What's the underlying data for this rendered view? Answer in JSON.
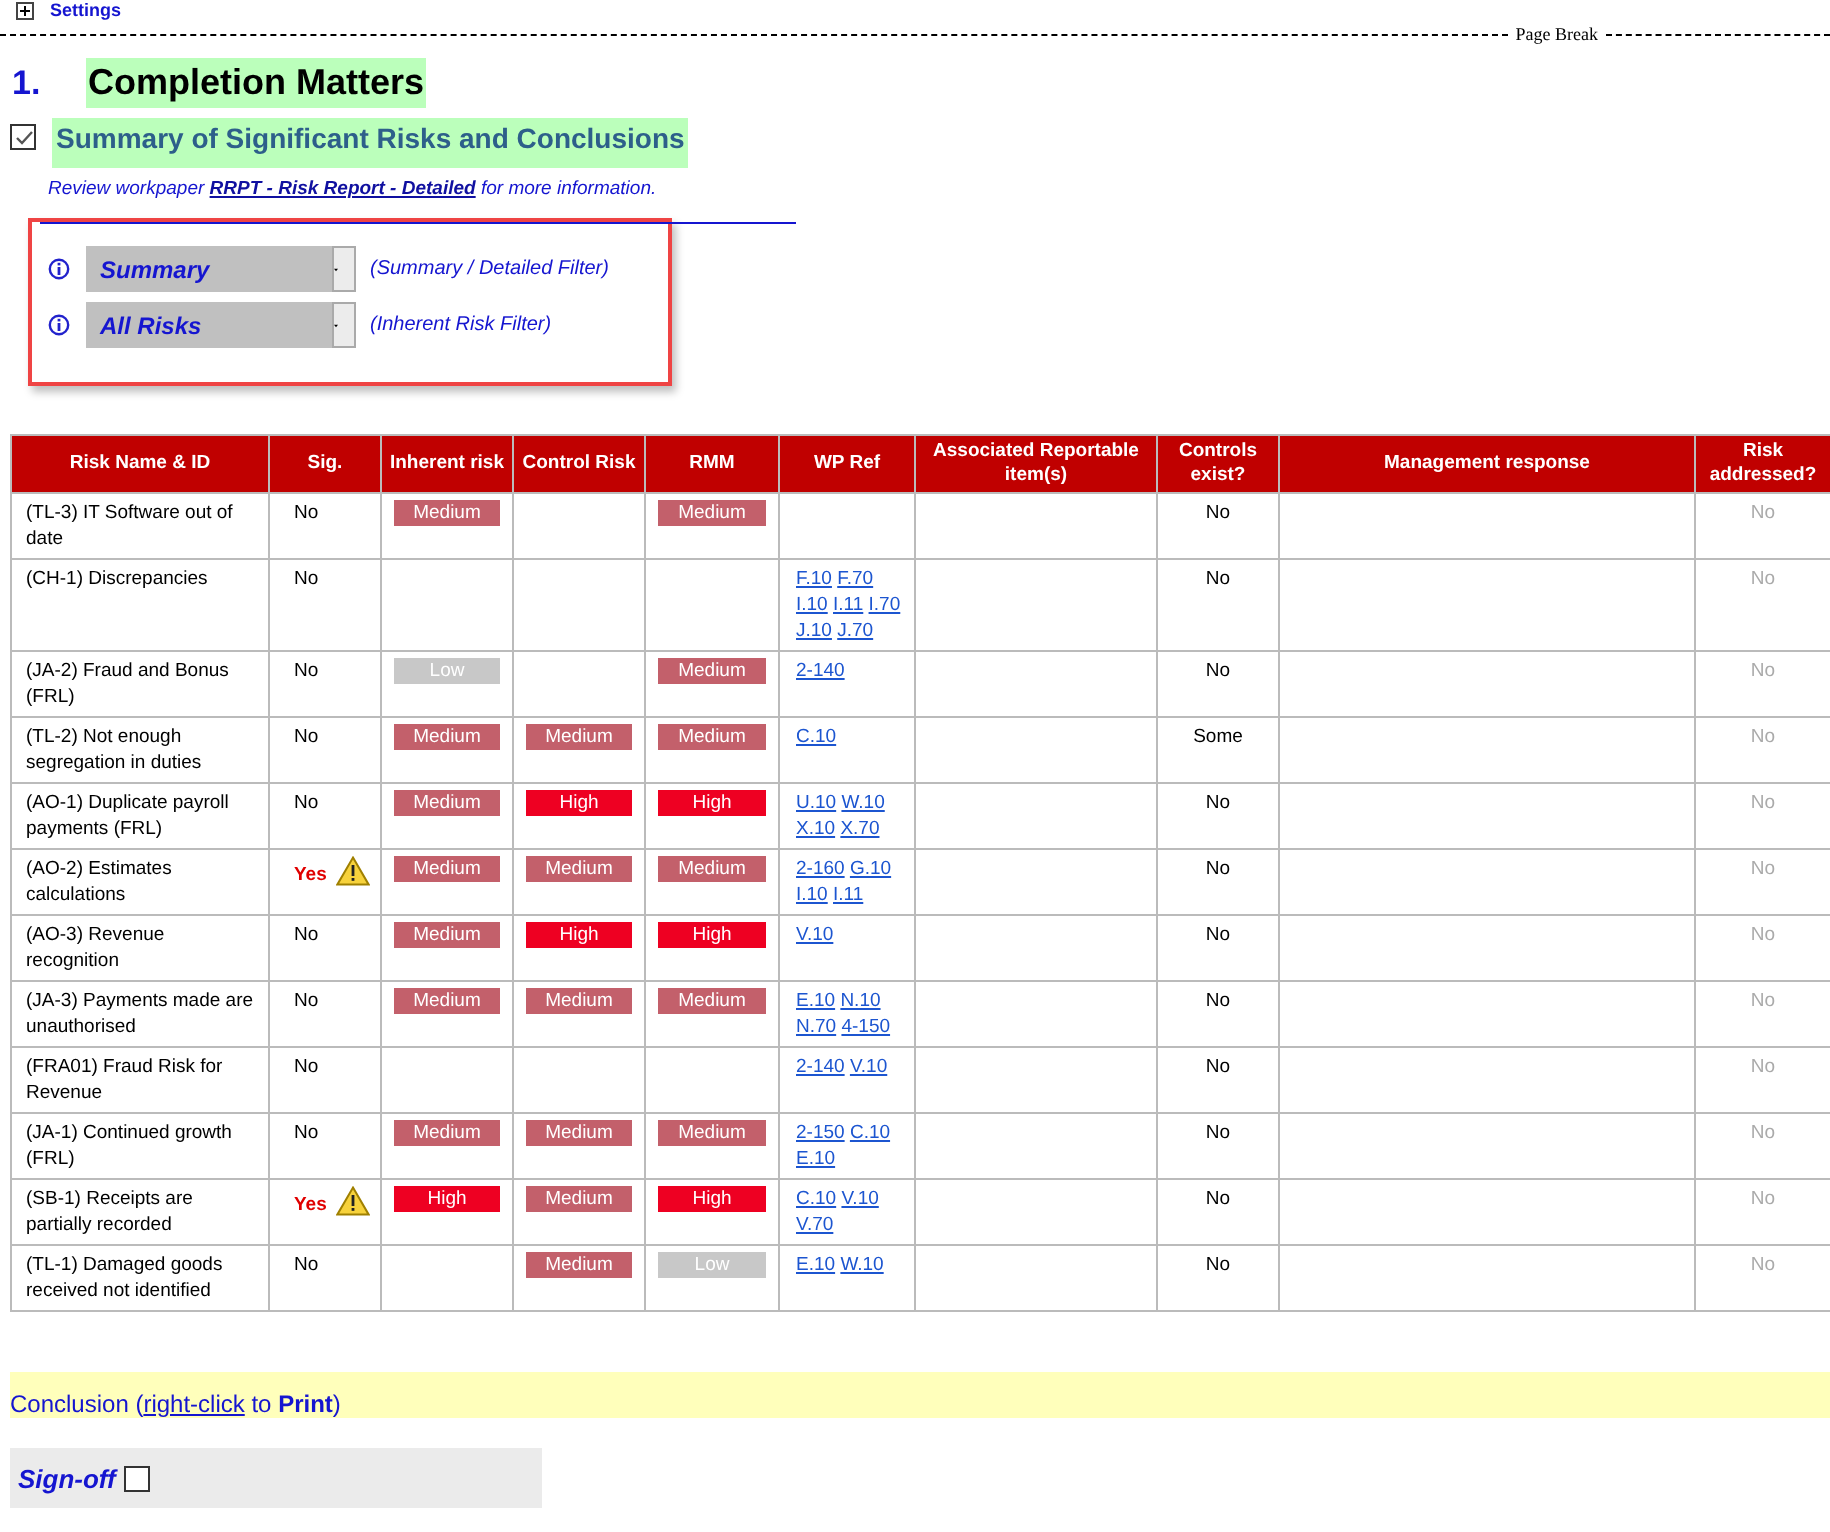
{
  "settings_link": "Settings",
  "page_break": "Page Break",
  "section": {
    "number": "1.",
    "title": "Completion Matters"
  },
  "subsection": {
    "checked": true,
    "title": "Summary of Significant Risks and Conclusions"
  },
  "review_note": {
    "prefix": "Review workpaper ",
    "link": "RRPT - Risk Report - Detailed",
    "suffix": " for more information."
  },
  "filters": [
    {
      "value": "Summary",
      "hint": "(Summary / Detailed Filter)"
    },
    {
      "value": "All Risks",
      "hint": "(Inherent Risk Filter)"
    }
  ],
  "table": {
    "columns": [
      "Risk Name & ID",
      "Sig.",
      "Inherent risk",
      "Control Risk",
      "RMM",
      "WP Ref",
      "Associated Reportable item(s)",
      "Controls exist?",
      "Management response",
      "Risk addressed?"
    ],
    "rows": [
      {
        "name": "(TL-3) IT Software out of date",
        "sig": "No",
        "warning": false,
        "inherent": {
          "text": "Medium",
          "kind": "medium"
        },
        "control": null,
        "rmm": {
          "text": "Medium",
          "kind": "medium"
        },
        "wp": [],
        "controls": "No",
        "addressed": "No"
      },
      {
        "name": "(CH-1) Discrepancies",
        "sig": "No",
        "warning": false,
        "inherent": null,
        "control": null,
        "rmm": null,
        "wp": [
          "F.10",
          "F.70",
          "I.10",
          "I.11",
          "I.70",
          "J.10",
          "J.70"
        ],
        "controls": "No",
        "addressed": "No"
      },
      {
        "name": "(JA-2) Fraud and Bonus (FRL)",
        "sig": "No",
        "warning": false,
        "inherent": {
          "text": "Low",
          "kind": "low"
        },
        "control": null,
        "rmm": {
          "text": "Medium",
          "kind": "medium"
        },
        "wp": [
          "2-140"
        ],
        "controls": "No",
        "addressed": "No"
      },
      {
        "name": "(TL-2) Not enough segregation in duties",
        "sig": "No",
        "warning": false,
        "inherent": {
          "text": "Medium",
          "kind": "medium"
        },
        "control": {
          "text": "Medium",
          "kind": "medium"
        },
        "rmm": {
          "text": "Medium",
          "kind": "medium"
        },
        "wp": [
          "C.10"
        ],
        "controls": "Some",
        "addressed": "No"
      },
      {
        "name": "(AO-1) Duplicate payroll payments (FRL)",
        "sig": "No",
        "warning": false,
        "inherent": {
          "text": "Medium",
          "kind": "medium"
        },
        "control": {
          "text": "High",
          "kind": "high"
        },
        "rmm": {
          "text": "High",
          "kind": "high"
        },
        "wp": [
          "U.10",
          "W.10",
          "X.10",
          "X.70"
        ],
        "controls": "No",
        "addressed": "No"
      },
      {
        "name": "(AO-2) Estimates calculations",
        "sig": "Yes",
        "warning": true,
        "inherent": {
          "text": "Medium",
          "kind": "medium"
        },
        "control": {
          "text": "Medium",
          "kind": "medium"
        },
        "rmm": {
          "text": "Medium",
          "kind": "medium"
        },
        "wp": [
          "2-160",
          "G.10",
          "I.10",
          "I.11"
        ],
        "controls": "No",
        "addressed": "No"
      },
      {
        "name": "(AO-3) Revenue recognition",
        "sig": "No",
        "warning": false,
        "inherent": {
          "text": "Medium",
          "kind": "medium"
        },
        "control": {
          "text": "High",
          "kind": "high"
        },
        "rmm": {
          "text": "High",
          "kind": "high"
        },
        "wp": [
          "V.10"
        ],
        "controls": "No",
        "addressed": "No"
      },
      {
        "name": "(JA-3) Payments made are unauthorised",
        "sig": "No",
        "warning": false,
        "inherent": {
          "text": "Medium",
          "kind": "medium"
        },
        "control": {
          "text": "Medium",
          "kind": "medium"
        },
        "rmm": {
          "text": "Medium",
          "kind": "medium"
        },
        "wp": [
          "E.10",
          "N.10",
          "N.70",
          "4-150"
        ],
        "controls": "No",
        "addressed": "No"
      },
      {
        "name": "(FRA01) Fraud Risk for Revenue",
        "sig": "No",
        "warning": false,
        "inherent": null,
        "control": null,
        "rmm": null,
        "wp": [
          "2-140",
          "V.10"
        ],
        "controls": "No",
        "addressed": "No"
      },
      {
        "name": "(JA-1) Continued growth (FRL)",
        "sig": "No",
        "warning": false,
        "inherent": {
          "text": "Medium",
          "kind": "medium"
        },
        "control": {
          "text": "Medium",
          "kind": "medium"
        },
        "rmm": {
          "text": "Medium",
          "kind": "medium"
        },
        "wp": [
          "2-150",
          "C.10",
          "E.10"
        ],
        "controls": "No",
        "addressed": "No"
      },
      {
        "name": "(SB-1) Receipts are partially recorded",
        "sig": "Yes",
        "warning": true,
        "inherent": {
          "text": "High",
          "kind": "high"
        },
        "control": {
          "text": "Medium",
          "kind": "medium"
        },
        "rmm": {
          "text": "High",
          "kind": "high"
        },
        "wp": [
          "C.10",
          "V.10",
          "V.70"
        ],
        "controls": "No",
        "addressed": "No"
      },
      {
        "name": "(TL-1) Damaged goods received not identified",
        "sig": "No",
        "warning": false,
        "inherent": null,
        "control": {
          "text": "Medium",
          "kind": "medium"
        },
        "rmm": {
          "text": "Low",
          "kind": "low"
        },
        "wp": [
          "E.10",
          "W.10"
        ],
        "controls": "No",
        "addressed": "No"
      }
    ]
  },
  "conclusion": {
    "prefix": "Conclusion (",
    "link": "right-click",
    "suffix": " to **Print**)"
  },
  "sign_off": {
    "label": "Sign-off",
    "checked": false
  }
}
